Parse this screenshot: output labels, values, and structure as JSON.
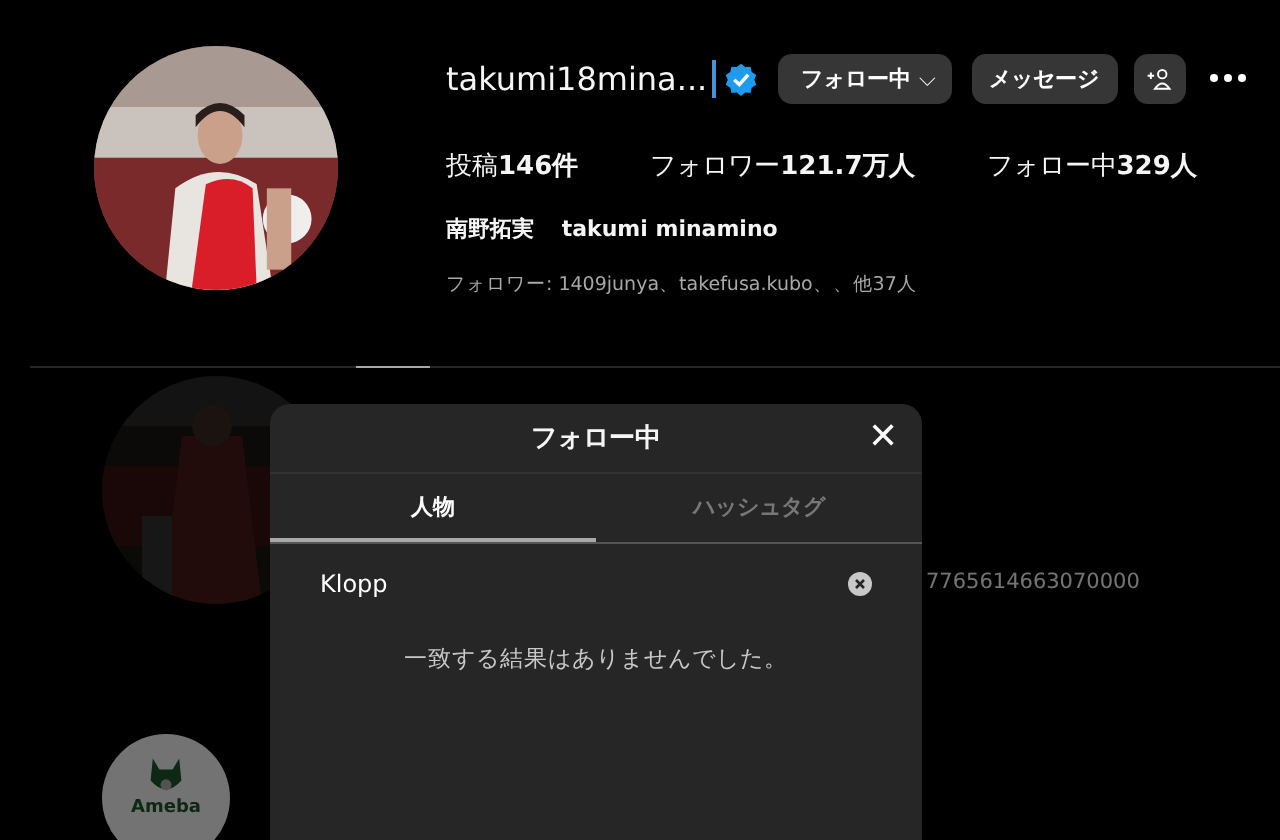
{
  "profile": {
    "username": "takumi18mina...",
    "verified": true,
    "follow_button": "フォロー中",
    "follow_menu": "⌵",
    "message_button": "メッセージ",
    "stats": [
      {
        "label": "投稿",
        "value": "146件"
      },
      {
        "label": "フォロワー",
        "value": "121.7万人"
      },
      {
        "label": "フォロー中",
        "value": "329人"
      }
    ],
    "full_name": "南野拓実",
    "alt_name": "takumi minamino",
    "followed_by": "フォロワー: 1409junya、takefusa.kubo、、他37人"
  },
  "tabs_bar": [
    {
      "selected": true
    }
  ],
  "background": {
    "number": "7765614663070000",
    "logo_text": "Ameba"
  },
  "dialog": {
    "title": "フォロー中",
    "close": "✕",
    "tabs": [
      {
        "label": "人物",
        "selected": true
      },
      {
        "label": "ハッシュタグ",
        "selected": false
      }
    ],
    "search": {
      "value": "Klopp"
    },
    "empty_message": "一致する結果はありませんでした。"
  }
}
